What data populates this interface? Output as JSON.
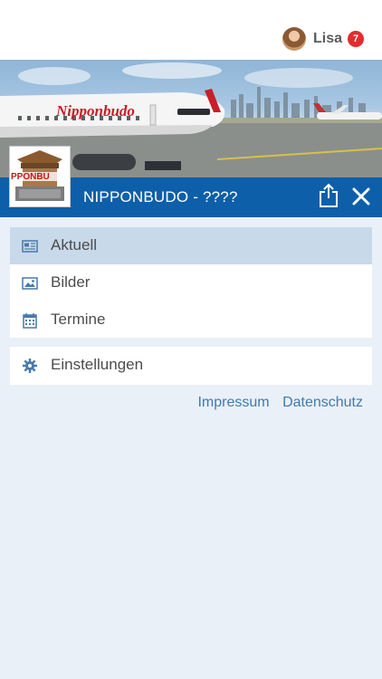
{
  "user": {
    "name": "Lisa",
    "notifications": "7"
  },
  "banner": {
    "airline_text": "Nipponbudo"
  },
  "club": {
    "title": "NIPPONBUDO - ????",
    "logo_text": "PPONBU"
  },
  "menu": {
    "items": [
      {
        "label": "Aktuell",
        "icon": "newspaper-icon",
        "active": true
      },
      {
        "label": "Bilder",
        "icon": "image-icon",
        "active": false
      },
      {
        "label": "Termine",
        "icon": "calendar-icon",
        "active": false
      }
    ],
    "settings": {
      "label": "Einstellungen",
      "icon": "gear-icon"
    }
  },
  "footer_links": {
    "impressum": "Impressum",
    "datenschutz": "Datenschutz"
  },
  "colors": {
    "primary": "#0d5fa9",
    "active_bg": "#c8d9ea",
    "link": "#3d7ab3",
    "badge": "#e32d2d"
  }
}
